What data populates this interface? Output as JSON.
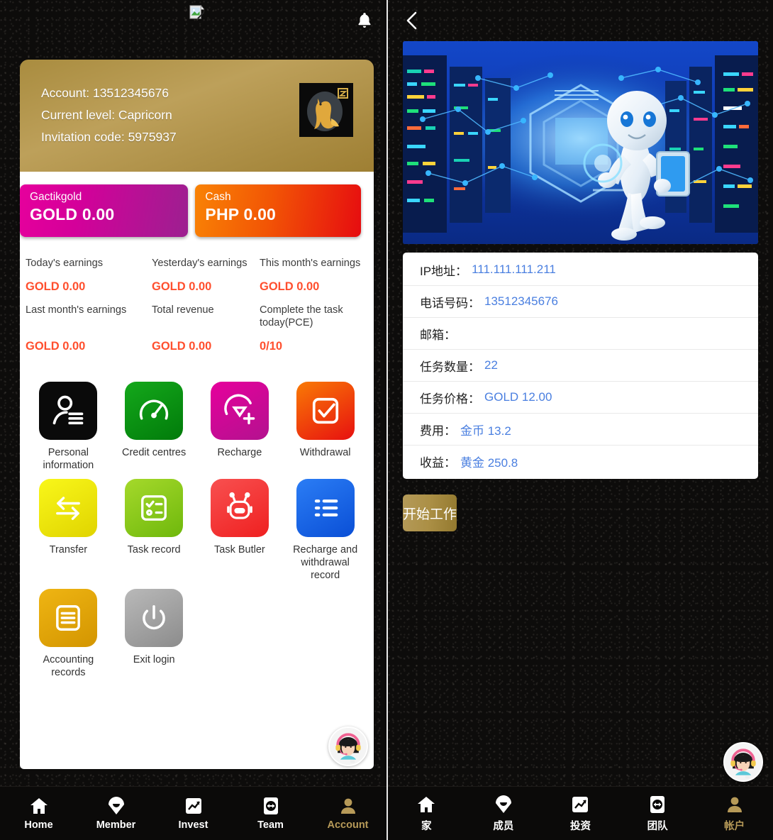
{
  "left": {
    "topbar": {
      "broken_image_icon": "broken-image-icon",
      "bell_icon": "bell-icon"
    },
    "profile": {
      "account_line": "Account: 13512345676",
      "level_line": "Current level: Capricorn",
      "invite_line": "Invitation code: 5975937",
      "zodiac_icon": "capricorn-icon"
    },
    "balances": [
      {
        "label": "Gactikgold",
        "amount": "GOLD 0.00",
        "color": "#d4009a"
      },
      {
        "label": "Cash",
        "amount": "PHP 0.00",
        "color": "#f25505"
      }
    ],
    "earnings": [
      {
        "title": "Today's earnings",
        "value": "GOLD 0.00"
      },
      {
        "title": "Yesterday's earnings",
        "value": "GOLD 0.00"
      },
      {
        "title": "This month's earnings",
        "value": "GOLD 0.00"
      },
      {
        "title": "Last month's earnings",
        "value": "GOLD 0.00"
      },
      {
        "title": "Total revenue",
        "value": "GOLD 0.00"
      },
      {
        "title": "Complete the task today(PCE)",
        "value": "0/10"
      }
    ],
    "earnings_color": "#ff4f2e",
    "menu": [
      {
        "label": "Personal information",
        "icon": "person-card-icon",
        "bg": "#0a0a0a"
      },
      {
        "label": "Credit centres",
        "icon": "speedometer-icon",
        "bg": "#0f9d16"
      },
      {
        "label": "Recharge",
        "icon": "diamond-plus-icon",
        "bg": "#d4009a"
      },
      {
        "label": "Withdrawal",
        "icon": "check-square-icon",
        "bg": "#f25505"
      },
      {
        "label": "Transfer",
        "icon": "transfer-arrows-icon",
        "bg": "#f0ec12"
      },
      {
        "label": "Task record",
        "icon": "checklist-icon",
        "bg": "#8dc81a"
      },
      {
        "label": "Task Butler",
        "icon": "robot-icon",
        "bg": "#f33a3a"
      },
      {
        "label": "Recharge and withdrawal record",
        "icon": "list-icon",
        "bg": "#1565f0"
      },
      {
        "label": "Accounting records",
        "icon": "ledger-icon",
        "bg": "#e0a906"
      },
      {
        "label": "Exit login",
        "icon": "power-icon",
        "bg": "#9e9e9e"
      }
    ],
    "support_avatar": "support-agent-avatar",
    "tabs": [
      {
        "label": "Home",
        "icon": "home-icon",
        "active": false
      },
      {
        "label": "Member",
        "icon": "diamond-heart-icon",
        "active": false
      },
      {
        "label": "Invest",
        "icon": "trend-chart-icon",
        "active": false
      },
      {
        "label": "Team",
        "icon": "team-arrows-icon",
        "active": false
      },
      {
        "label": "Account",
        "icon": "user-icon",
        "active": true
      }
    ],
    "active_tab_color": "#b79a58"
  },
  "right": {
    "back_icon": "back-chevron-icon",
    "banner_alt": "ai-robot-data-center-banner",
    "info_rows": [
      {
        "key": "IP地址：",
        "value": "111.111.111.211"
      },
      {
        "key": "电话号码：",
        "value": "13512345676"
      },
      {
        "key": "邮箱：",
        "value": ""
      },
      {
        "key": "任务数量：",
        "value": "22"
      },
      {
        "key": "任务价格：",
        "value": "GOLD 12.00"
      },
      {
        "key": "费用：",
        "value": "金币 13.2"
      },
      {
        "key": "收益：",
        "value": "黄金 250.8"
      }
    ],
    "value_color": "#4a7fe0",
    "start_button": "开始工作",
    "support_avatar": "support-agent-avatar",
    "tabs": [
      {
        "label": "家",
        "icon": "home-icon",
        "active": false
      },
      {
        "label": "成员",
        "icon": "diamond-heart-icon",
        "active": false
      },
      {
        "label": "投资",
        "icon": "trend-chart-icon",
        "active": false
      },
      {
        "label": "团队",
        "icon": "team-arrows-icon",
        "active": false
      },
      {
        "label": "帐户",
        "icon": "user-icon",
        "active": true
      }
    ]
  }
}
